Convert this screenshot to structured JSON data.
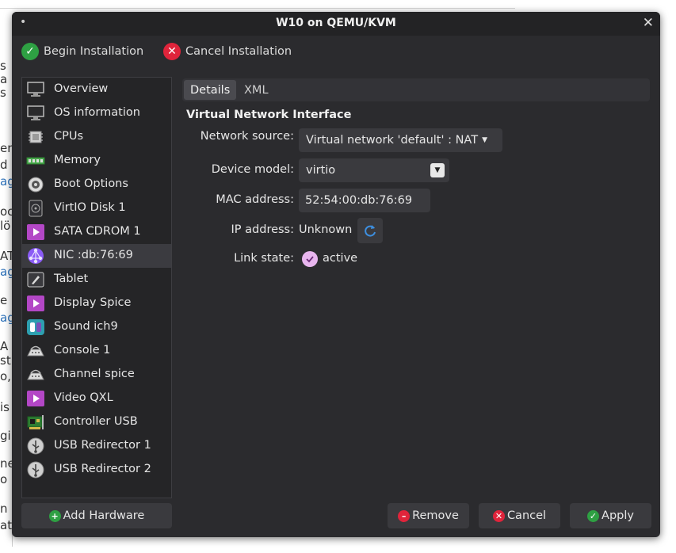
{
  "background_page": {
    "fragments": [
      {
        "text": "s",
        "link": false
      },
      {
        "text": "a",
        "link": false
      },
      {
        "text": "s",
        "link": false
      },
      {
        "text": "en",
        "link": false
      },
      {
        "text": "d",
        "link": false
      },
      {
        "text": "ag",
        "link": true
      },
      {
        "text": "oc",
        "link": false
      },
      {
        "text": "lö",
        "link": false
      },
      {
        "text": "AT",
        "link": false
      },
      {
        "text": "ag",
        "link": true
      },
      {
        "text": "e",
        "link": false
      },
      {
        "text": "ag",
        "link": true
      },
      {
        "text": "A",
        "link": false
      },
      {
        "text": "st",
        "link": false
      },
      {
        "text": "o,",
        "link": false
      },
      {
        "text": "is",
        "link": false
      },
      {
        "text": "gi",
        "link": false
      },
      {
        "text": "ne",
        "link": false
      },
      {
        "text": "o",
        "link": false
      },
      {
        "text": "n",
        "link": false
      },
      {
        "text": "at",
        "link": false
      }
    ]
  },
  "window": {
    "title": "W10 on QEMU/KVM",
    "menu_glyph": "•",
    "close_glyph": "✕"
  },
  "toolbar": {
    "begin_label": "Begin Installation",
    "cancel_label": "Cancel Installation"
  },
  "sidebar": {
    "items": [
      {
        "label": "Overview",
        "icon": "monitor-icon"
      },
      {
        "label": "OS information",
        "icon": "monitor-icon"
      },
      {
        "label": "CPUs",
        "icon": "cpu-icon"
      },
      {
        "label": "Memory",
        "icon": "memory-icon"
      },
      {
        "label": "Boot Options",
        "icon": "gear-icon"
      },
      {
        "label": "VirtIO Disk 1",
        "icon": "disk-icon"
      },
      {
        "label": "SATA CDROM 1",
        "icon": "media-play-icon"
      },
      {
        "label": "NIC :db:76:69",
        "icon": "network-icon"
      },
      {
        "label": "Tablet",
        "icon": "tablet-icon"
      },
      {
        "label": "Display Spice",
        "icon": "media-play-icon"
      },
      {
        "label": "Sound ich9",
        "icon": "sound-icon"
      },
      {
        "label": "Console 1",
        "icon": "serial-icon"
      },
      {
        "label": "Channel spice",
        "icon": "serial-icon"
      },
      {
        "label": "Video QXL",
        "icon": "media-play-icon"
      },
      {
        "label": "Controller USB",
        "icon": "controller-card-icon"
      },
      {
        "label": "USB Redirector 1",
        "icon": "usb-icon"
      },
      {
        "label": "USB Redirector 2",
        "icon": "usb-icon"
      }
    ],
    "selected_index": 7,
    "add_hardware_label": "Add Hardware"
  },
  "tabs": {
    "details_label": "Details",
    "xml_label": "XML",
    "active": "Details"
  },
  "detail": {
    "heading": "Virtual Network Interface",
    "network_source_label": "Network source:",
    "network_source_value": "Virtual network 'default' : NAT",
    "device_model_label": "Device model:",
    "device_model_value": "virtio",
    "mac_label": "MAC address:",
    "mac_value": "52:54:00:db:76:69",
    "ip_label": "IP address:",
    "ip_value": "Unknown",
    "link_label": "Link state:",
    "link_value": "active",
    "link_active": true
  },
  "buttons": {
    "remove_label": "Remove",
    "cancel_label": "Cancel",
    "apply_label": "Apply"
  },
  "colors": {
    "window_bg": "#2b2b2e",
    "accent_green": "#2ea043",
    "accent_red": "#e0243b",
    "nic_purple": "#8b5cf6",
    "media_magenta": "#b347c6",
    "refresh_blue": "#3d8fe0",
    "link_checkbox": "#e8b5ee"
  }
}
